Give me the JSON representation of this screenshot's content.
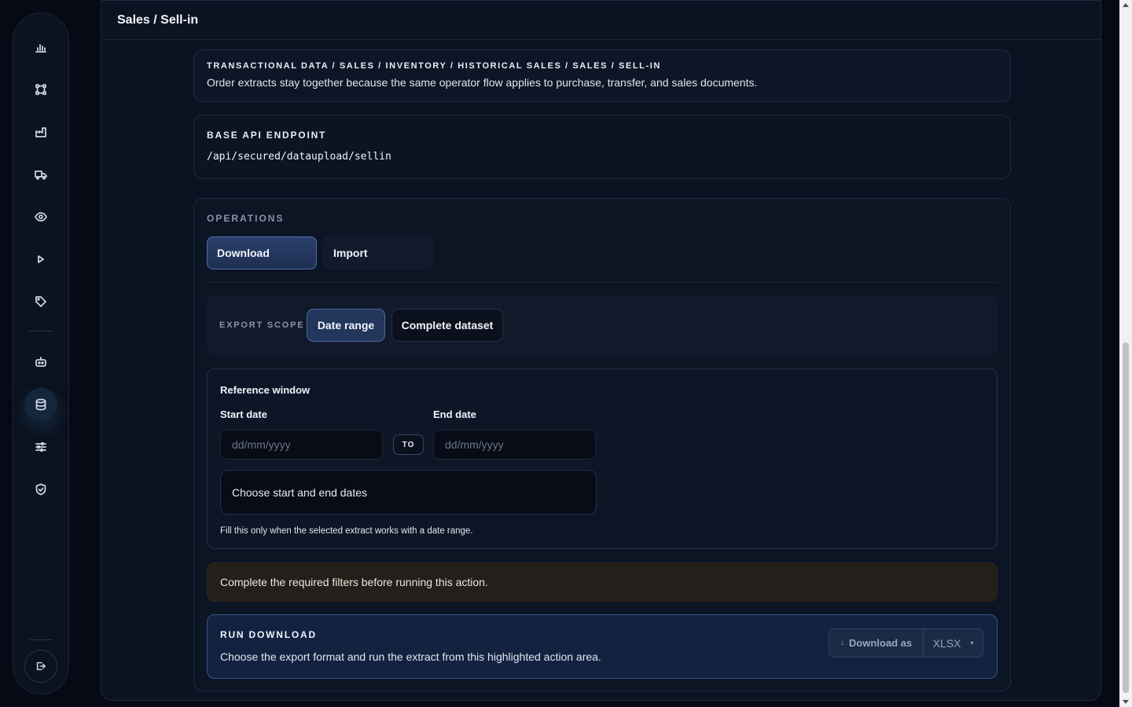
{
  "header": {
    "title": "Sales / Sell-in"
  },
  "breadcrumb": {
    "path": "TRANSACTIONAL DATA / SALES / INVENTORY / HISTORICAL SALES / SALES / SELL-IN",
    "description": "Order extracts stay together because the same operator flow applies to purchase, transfer, and sales documents."
  },
  "endpoint": {
    "label": "BASE API ENDPOINT",
    "path": "/api/secured/dataupload/sellin"
  },
  "operations": {
    "label": "OPERATIONS",
    "tabs": [
      {
        "label": "Download",
        "active": true
      },
      {
        "label": "Import",
        "active": false
      }
    ]
  },
  "scope": {
    "label": "EXPORT SCOPE",
    "options": [
      {
        "label": "Date range",
        "active": true
      },
      {
        "label": "Complete dataset",
        "active": false
      }
    ]
  },
  "window": {
    "title": "Reference window",
    "start_label": "Start date",
    "end_label": "End date",
    "start_placeholder": "dd/mm/yyyy",
    "end_placeholder": "dd/mm/yyyy",
    "to_label": "TO",
    "summary": "Choose start and end dates",
    "hint": "Fill this only when the selected extract works with a date range."
  },
  "warning": {
    "text": "Complete the required filters before running this action."
  },
  "run": {
    "title": "RUN DOWNLOAD",
    "description": "Choose the export format and run the extract from this highlighted action area.",
    "button_label": "Download as",
    "format": "XLSX",
    "arrow": "↓",
    "caret": "▾"
  },
  "sidebar": {
    "icons": [
      "bar-chart-icon",
      "workflow-icon",
      "factory-icon",
      "truck-icon",
      "eye-icon",
      "play-icon",
      "tag-icon",
      "robot-icon",
      "database-icon",
      "sliders-icon",
      "shield-check-icon"
    ],
    "active": "database-icon",
    "logout": "logout-icon"
  }
}
